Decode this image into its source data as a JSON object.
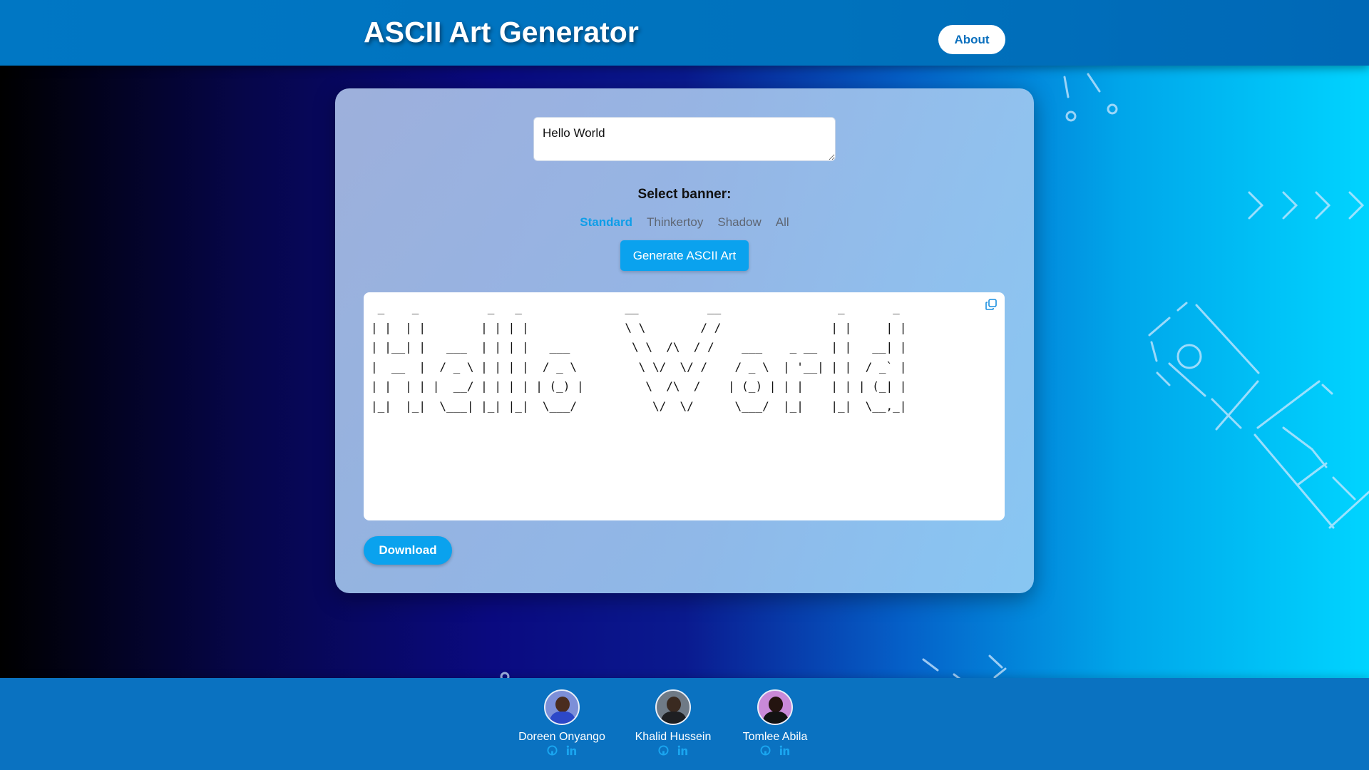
{
  "header": {
    "title": "ASCII Art Generator",
    "about_label": "About"
  },
  "generator": {
    "input_value": "Hello World",
    "select_banner_label": "Select banner:",
    "banner_options": [
      "Standard",
      "Thinkertoy",
      "Shadow",
      "All"
    ],
    "selected_banner": "Standard",
    "generate_label": "Generate ASCII Art",
    "output": " _    _          _   _               __          __                 _       _ \n| |  | |        | | | |              \\ \\        / /                | |     | |\n| |__| |   ___  | | | |   ___         \\ \\  /\\  / /    ___    _ __  | |   __| |\n|  __  |  / _ \\ | | | |  / _ \\         \\ \\/  \\/ /    / _ \\  | '__| | |  / _` |\n| |  | | |  __/ | | | | | (_) |         \\  /\\  /    | (_) | | |    | | | (_| |\n|_|  |_|  \\___| |_| |_|  \\___/           \\/  \\/      \\___/  |_|    |_|  \\__,_|",
    "download_label": "Download"
  },
  "footer": {
    "members": [
      {
        "name": "Doreen Onyango"
      },
      {
        "name": "Khalid Hussein"
      },
      {
        "name": "Tomlee Abila"
      }
    ]
  },
  "colors": {
    "accent": "#0aa2ee",
    "header_bg": "#0072bd",
    "footer_bg": "#0a72c1"
  },
  "icons": [
    "copy-icon",
    "github-icon",
    "linkedin-icon"
  ]
}
